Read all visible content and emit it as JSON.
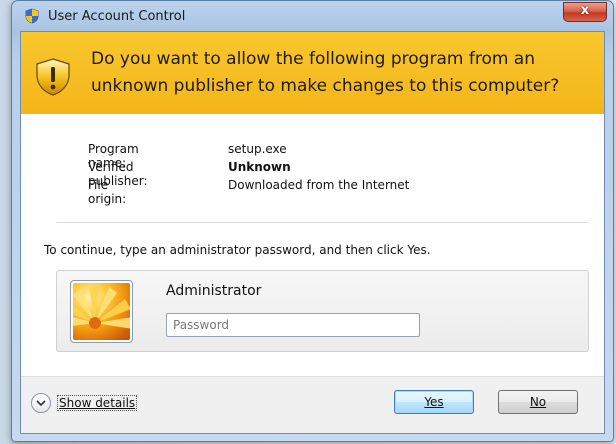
{
  "window": {
    "title": "User Account Control",
    "close_label": "x"
  },
  "banner": {
    "message": "Do you want to allow the following program from an unknown publisher to make changes to this computer?"
  },
  "details": [
    {
      "label": "Program name:",
      "value": "setup.exe",
      "bold": false
    },
    {
      "label": "Verified publisher:",
      "value": "Unknown",
      "bold": true
    },
    {
      "label": "File origin:",
      "value": "Downloaded from the Internet",
      "bold": false
    }
  ],
  "instruction": "To continue, type an administrator password, and then click Yes.",
  "credential": {
    "user_name": "Administrator",
    "password_value": "",
    "password_placeholder": "Password"
  },
  "footer": {
    "show_details_label": "Show details",
    "yes_label": "Yes",
    "no_label": "No"
  },
  "icons": {
    "title_icon": "uac-shield-icon",
    "banner_icon": "warning-shield-icon",
    "toggle_icon": "chevron-down-icon"
  },
  "colors": {
    "banner_bg": "#f3b61a",
    "default_button": "#3c7fb1",
    "close_button": "#c23a22"
  }
}
